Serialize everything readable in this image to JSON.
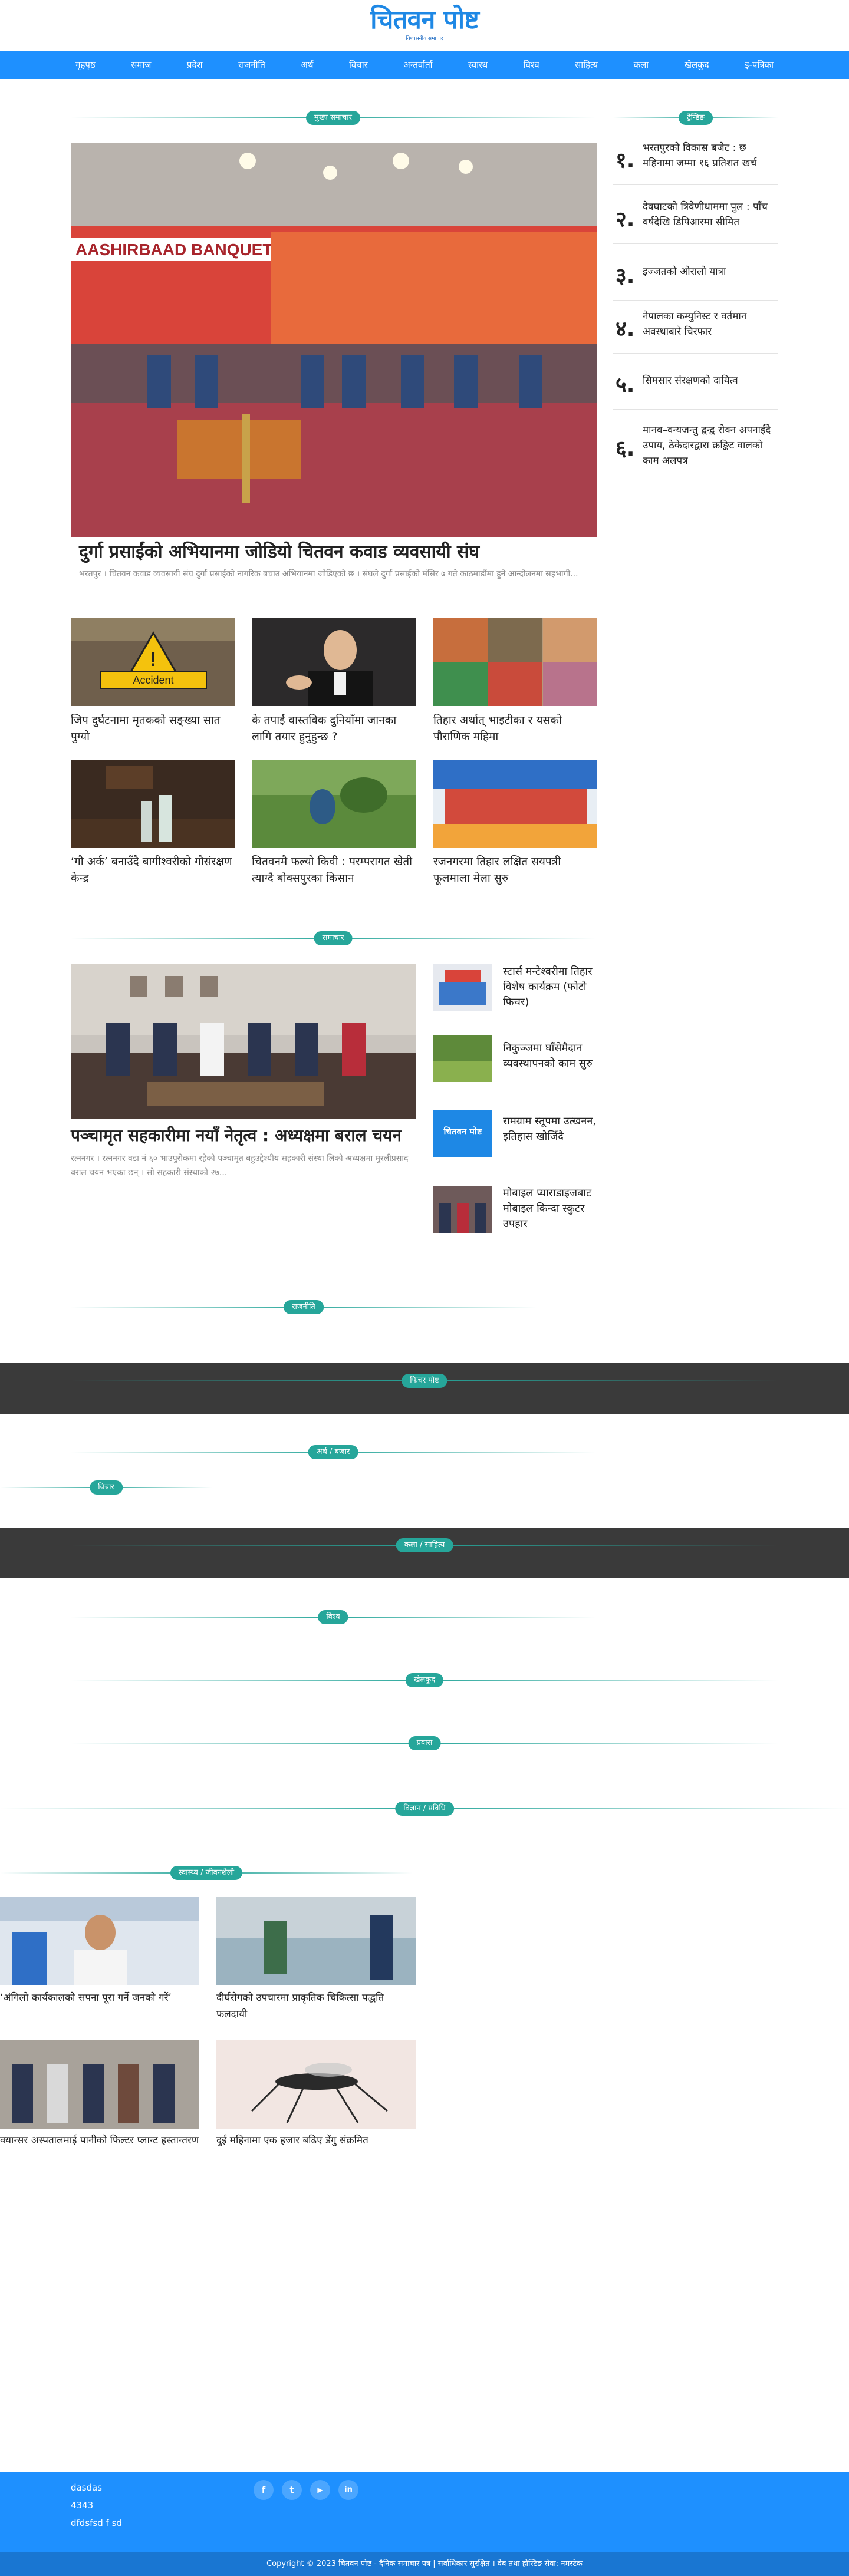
{
  "header": {
    "logo_text": "चितवन पोष्ट",
    "logo_tagline": "विश्वसनीय समाचार"
  },
  "nav": [
    "गृहपृष्ठ",
    "समाज",
    "प्रदेश",
    "राजनीति",
    "अर्थ",
    "विचार",
    "अन्तर्वार्ता",
    "स्वास्थ",
    "विश्व",
    "साहित्य",
    "कला",
    "खेलकुद",
    "इ-पत्रिका"
  ],
  "sections": {
    "main_news": "मुख्य समाचार",
    "trending": "ट्रेन्डिङ",
    "news": "समाचार",
    "politics": "राजनीति",
    "feature": "फिचर पोष्ट",
    "economy": "अर्थ / बजार",
    "opinion": "विचार",
    "arts": "कला / साहित्य",
    "world": "विश्व",
    "sports": "खेलकुद",
    "province": "प्रवास",
    "science": "विज्ञान / प्रविधि",
    "health": "स्वास्थ्य / जीवनशैली"
  },
  "main_story": {
    "title": "दुर्गा प्रसाईंको अभियानमा जोडियो चितवन कवाड व्यवसायी संघ",
    "excerpt": "भरतपुर । चितवन कवाड व्यवसायी संघ दुर्गा प्रसाईंको नागरिक बचाउ अभियानमा जोडिएको छ । संघले दुर्गा प्रसाईंको मंसिर ७ गते काठमाडौंमा हुने आन्दोलनमा सहभागी...",
    "banner_text": "AASHIRBAAD BANQUET PVT. LTD."
  },
  "grid_stories": [
    {
      "title": "जिप दुर्घटनामा मृतकको सङ्ख्या सात पुग्यो",
      "badge": "Accident"
    },
    {
      "title": "के तपाईं वास्तविक दुनियाँमा जानका लागि तयार हुनुहुन्छ ?"
    },
    {
      "title": "तिहार अर्थात् भाइटीका र यसको पौराणिक महिमा"
    },
    {
      "title": "‘गौ अर्क’ बनाउँदै बागीश्वरीको गौसंरक्षण केन्द्र"
    },
    {
      "title": "चितवनमै फल्यो किवी : परम्परागत खेती त्याग्दै बोक्सपुरका किसान"
    },
    {
      "title": "रजनगरमा तिहार लक्षित सयपत्री फूलमाला मेला सुरु"
    }
  ],
  "trending": [
    {
      "num": "१.",
      "title": "भरतपुरको विकास बजेट : छ महिनामा जम्मा १६ प्रतिशत खर्च"
    },
    {
      "num": "२.",
      "title": "देवघाटको त्रिवेणीधाममा पुल : पाँच वर्षदेखि डिपिआरमा सीमित"
    },
    {
      "num": "३.",
      "title": "इज्जतको ओरालो यात्रा"
    },
    {
      "num": "४.",
      "title": "नेपालका कम्युनिस्ट र वर्तमान अवस्थाबारे चिरफार"
    },
    {
      "num": "५.",
      "title": "सिमसार संरक्षणको दायित्व"
    },
    {
      "num": "६.",
      "title": "मानव–वन्यजन्तु द्वन्द्व रोक्न अपनाईंदै उपाय, ठेकेदारद्वारा क्रङ्किट वालको काम अलपत्र"
    }
  ],
  "news_main": {
    "title": "पञ्चामृत सहकारीमा नयाँ नेतृत्व : अध्यक्षमा बराल चयन",
    "excerpt": "रत्ननगर । रत्ननगर वडा नं ६० भाउपुरोकमा रहेको पञ्चामृत बहुउद्देश्यीय सहकारी संस्था लिको अध्यक्षमा मुरलीप्रसाद बराल चयन भएका छन् । सो सहकारी संस्थाको २७..."
  },
  "news_side": [
    {
      "title": "स्टार्स मन्टेश्वरीमा तिहार विशेष कार्यक्रम (फोटो फिचर)"
    },
    {
      "title": "निकुञ्जमा घाँसेमैदान व्यवस्थापनको काम सुरु"
    },
    {
      "title": "रामग्राम स्तूपमा उत्खनन, इतिहास खोजिँदै",
      "thumb_text": "चितवन पोष्ट"
    },
    {
      "title": "मोबाइल प्याराडाइजबाट मोबाइल किन्दा स्कुटर उपहार"
    }
  ],
  "health_stories": [
    {
      "title": "‘अंगिलो कार्यकालको सपना पूरा गर्ने जनको गरें’"
    },
    {
      "title": "दीर्घरोगको उपचारमा प्राकृतिक चिकित्सा पद्धति फलदायी"
    },
    {
      "title": "क्यान्सर अस्पतालमाई पानीको फिल्टर प्लान्ट हस्तान्तरण"
    },
    {
      "title": "दुई महिनामा एक हजार बढिए डेंगु संक्रमित"
    }
  ],
  "footer": {
    "line1": "dasdas",
    "line2": "4343",
    "line3": "dfdsfsd f sd",
    "social": [
      "f",
      "t",
      "▶",
      "in"
    ],
    "copyright": "Copyright © 2023 चितवन पोष्ट - दैनिक समाचार पत्र | सर्वाधिकार सुरक्षित । वेब तथा होस्टिङ सेवा: नमस्टेक"
  },
  "colors": {
    "brand": "#1e90ff",
    "accent": "#26a69a",
    "dark_band": "#3a3a3a"
  }
}
